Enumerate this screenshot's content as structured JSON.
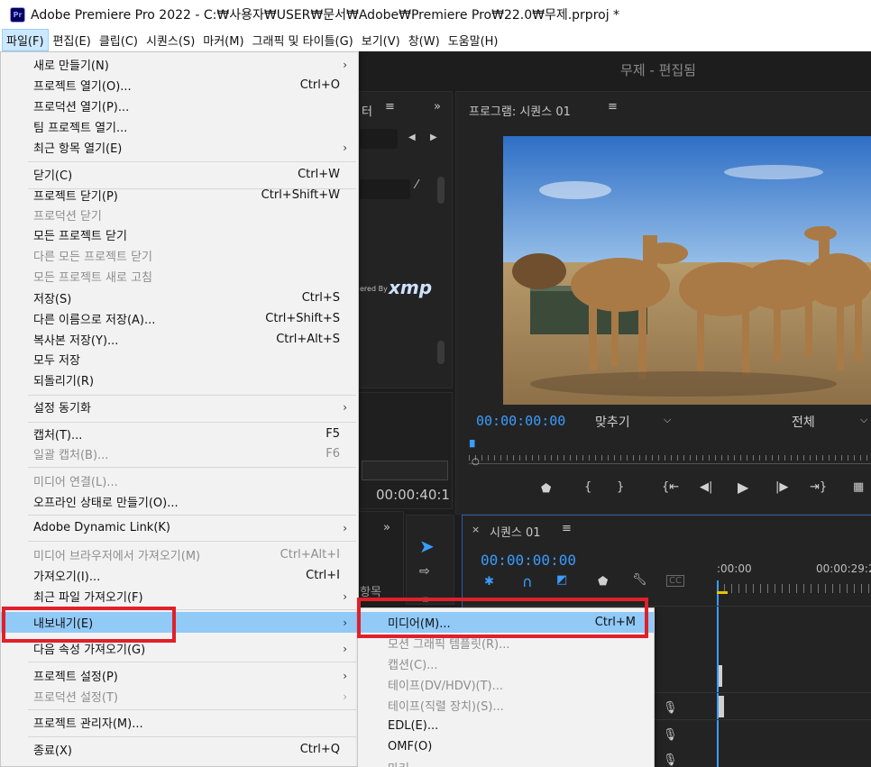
{
  "window": {
    "title": "Adobe Premiere Pro 2022 - C:₩사용자₩USER₩문서₩Adobe₩Premiere Pro₩22.0₩무제.prproj *",
    "logo": "Pr"
  },
  "menubar": [
    "파일(F)",
    "편집(E)",
    "클립(C)",
    "시퀀스(S)",
    "마커(M)",
    "그래픽 및 타이틀(G)",
    "보기(V)",
    "창(W)",
    "도움말(H)"
  ],
  "workspace_title": "무제 - 편집됨",
  "project_panel": {
    "tab_fragment": "터",
    "xmp_prefix": "ered By",
    "xmp_logo": "xmp",
    "timecode": "00:00:40:1"
  },
  "program_monitor": {
    "title": "프로그램: 시퀀스 01",
    "timecode": "00:00:00:00",
    "fit": "맞추기",
    "resolution": "전체"
  },
  "tools_panel": {
    "items_label": "항목"
  },
  "timeline": {
    "title": "시퀀스 01",
    "timecode": "00:00:00:00",
    "ruler_start": ":00:00",
    "ruler_end": "00:00:29:2"
  },
  "file_menu": [
    {
      "label": "새로 만들기(N)",
      "shortcut": "",
      "submenu": true,
      "disabled": false
    },
    {
      "label": "프로젝트 열기(O)...",
      "shortcut": "Ctrl+O",
      "submenu": false,
      "disabled": false
    },
    {
      "label": "프로덕션 열기(P)...",
      "shortcut": "",
      "submenu": false,
      "disabled": false
    },
    {
      "label": "팀 프로젝트 열기...",
      "shortcut": "",
      "submenu": false,
      "disabled": false
    },
    {
      "label": "최근 항목 열기(E)",
      "shortcut": "",
      "submenu": true,
      "disabled": false
    },
    {
      "label": "닫기(C)",
      "shortcut": "Ctrl+W",
      "submenu": false,
      "disabled": false
    },
    {
      "label": "프로젝트 닫기(P)",
      "shortcut": "Ctrl+Shift+W",
      "submenu": false,
      "disabled": false
    },
    {
      "label": "프로덕션 닫기",
      "shortcut": "",
      "submenu": false,
      "disabled": true
    },
    {
      "label": "모든 프로젝트 닫기",
      "shortcut": "",
      "submenu": false,
      "disabled": false
    },
    {
      "label": "다른 모든 프로젝트 닫기",
      "shortcut": "",
      "submenu": false,
      "disabled": true
    },
    {
      "label": "모든 프로젝트 새로 고침",
      "shortcut": "",
      "submenu": false,
      "disabled": true
    },
    {
      "label": "저장(S)",
      "shortcut": "Ctrl+S",
      "submenu": false,
      "disabled": false
    },
    {
      "label": "다른 이름으로 저장(A)...",
      "shortcut": "Ctrl+Shift+S",
      "submenu": false,
      "disabled": false
    },
    {
      "label": "복사본 저장(Y)...",
      "shortcut": "Ctrl+Alt+S",
      "submenu": false,
      "disabled": false
    },
    {
      "label": "모두 저장",
      "shortcut": "",
      "submenu": false,
      "disabled": false
    },
    {
      "label": "되돌리기(R)",
      "shortcut": "",
      "submenu": false,
      "disabled": false
    },
    {
      "label": "설정 동기화",
      "shortcut": "",
      "submenu": true,
      "disabled": false
    },
    {
      "label": "캡처(T)...",
      "shortcut": "F5",
      "submenu": false,
      "disabled": false
    },
    {
      "label": "일괄 캡처(B)...",
      "shortcut": "F6",
      "submenu": false,
      "disabled": true
    },
    {
      "label": "미디어 연결(L)...",
      "shortcut": "",
      "submenu": false,
      "disabled": true
    },
    {
      "label": "오프라인 상태로 만들기(O)...",
      "shortcut": "",
      "submenu": false,
      "disabled": false
    },
    {
      "label": "Adobe Dynamic Link(K)",
      "shortcut": "",
      "submenu": true,
      "disabled": false
    },
    {
      "label": "미디어 브라우저에서 가져오기(M)",
      "shortcut": "Ctrl+Alt+I",
      "submenu": false,
      "disabled": true
    },
    {
      "label": "가져오기(I)...",
      "shortcut": "Ctrl+I",
      "submenu": false,
      "disabled": false
    },
    {
      "label": "최근 파일 가져오기(F)",
      "shortcut": "",
      "submenu": true,
      "disabled": false
    },
    {
      "label": "내보내기(E)",
      "shortcut": "",
      "submenu": true,
      "disabled": false,
      "highlighted": true
    },
    {
      "label": "다음 속성 가져오기(G)",
      "shortcut": "",
      "submenu": true,
      "disabled": false
    },
    {
      "label": "프로젝트 설정(P)",
      "shortcut": "",
      "submenu": true,
      "disabled": false
    },
    {
      "label": "프로덕션 설정(T)",
      "shortcut": "",
      "submenu": true,
      "disabled": true
    },
    {
      "label": "프로젝트 관리자(M)...",
      "shortcut": "",
      "submenu": false,
      "disabled": false
    },
    {
      "label": "종료(X)",
      "shortcut": "Ctrl+Q",
      "submenu": false,
      "disabled": false
    }
  ],
  "export_menu": [
    {
      "label": "미디어(M)...",
      "shortcut": "Ctrl+M",
      "disabled": false,
      "highlighted": true
    },
    {
      "label": "모션 그래픽 템플릿(R)...",
      "shortcut": "",
      "disabled": true
    },
    {
      "label": "캡션(C)...",
      "shortcut": "",
      "disabled": true
    },
    {
      "label": "테이프(DV/HDV)(T)...",
      "shortcut": "",
      "disabled": true
    },
    {
      "label": "테이프(직렬 장치)(S)...",
      "shortcut": "",
      "disabled": true
    },
    {
      "label": "EDL(E)...",
      "shortcut": "",
      "disabled": false
    },
    {
      "label": "OMF(O)",
      "shortcut": "",
      "disabled": false
    },
    {
      "label": "마커",
      "shortcut": "",
      "disabled": true
    }
  ],
  "colors": {
    "accent_red": "#e0202a",
    "menu_highlight": "#91c9f7",
    "timecode_blue": "#3a9cff"
  }
}
